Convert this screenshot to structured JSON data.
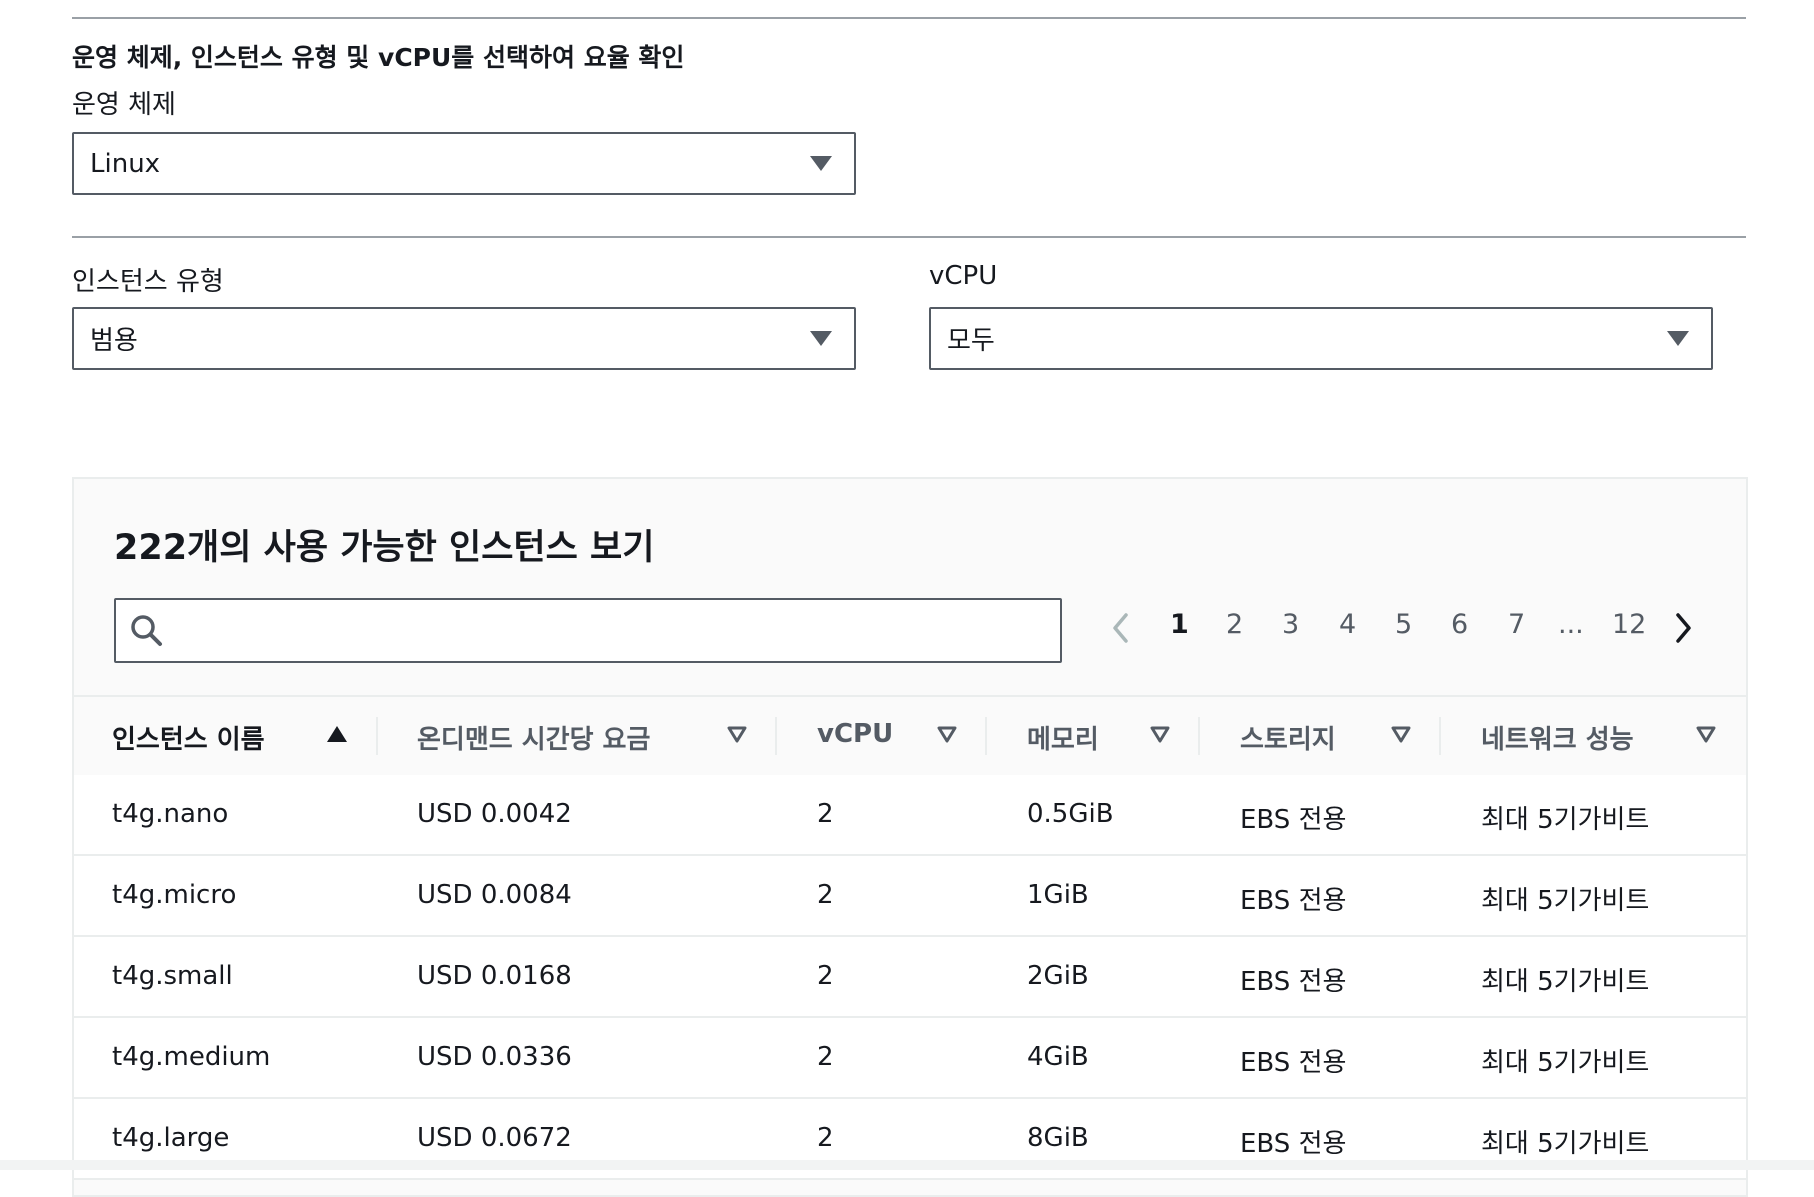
{
  "heading": "운영 체제, 인스턴스 유형 및 vCPU를 선택하여 요율 확인",
  "os": {
    "label": "운영 체제",
    "value": "Linux"
  },
  "instance_type": {
    "label": "인스턴스 유형",
    "value": "범용"
  },
  "vcpu": {
    "label": "vCPU",
    "value": "모두"
  },
  "panel": {
    "title": "222개의 사용 가능한 인스턴스 보기",
    "search_value": "",
    "pagination": {
      "pages": [
        "1",
        "2",
        "3",
        "4",
        "5",
        "6",
        "7",
        "...",
        "12"
      ],
      "current": "1"
    }
  },
  "table": {
    "columns": [
      "인스턴스 이름",
      "온디맨드 시간당 요금",
      "vCPU",
      "메모리",
      "스토리지",
      "네트워크 성능"
    ],
    "sorted_column": "인스턴스 이름",
    "rows": [
      [
        "t4g.nano",
        "USD 0.0042",
        "2",
        "0.5GiB",
        "EBS 전용",
        "최대 5기가비트"
      ],
      [
        "t4g.micro",
        "USD 0.0084",
        "2",
        "1GiB",
        "EBS 전용",
        "최대 5기가비트"
      ],
      [
        "t4g.small",
        "USD 0.0168",
        "2",
        "2GiB",
        "EBS 전용",
        "최대 5기가비트"
      ],
      [
        "t4g.medium",
        "USD 0.0336",
        "2",
        "4GiB",
        "EBS 전용",
        "최대 5기가비트"
      ],
      [
        "t4g.large",
        "USD 0.0672",
        "2",
        "8GiB",
        "EBS 전용",
        "최대 5기가비트"
      ]
    ]
  },
  "colors": {
    "text": "#16191f",
    "muted": "#545b64",
    "border": "#eaeded",
    "panel_bg": "#fafafa"
  },
  "icons": [
    "search-icon",
    "chevron-left-icon",
    "chevron-right-icon",
    "caret-down-icon",
    "sort-ascending-icon",
    "sort-descending-icon"
  ]
}
